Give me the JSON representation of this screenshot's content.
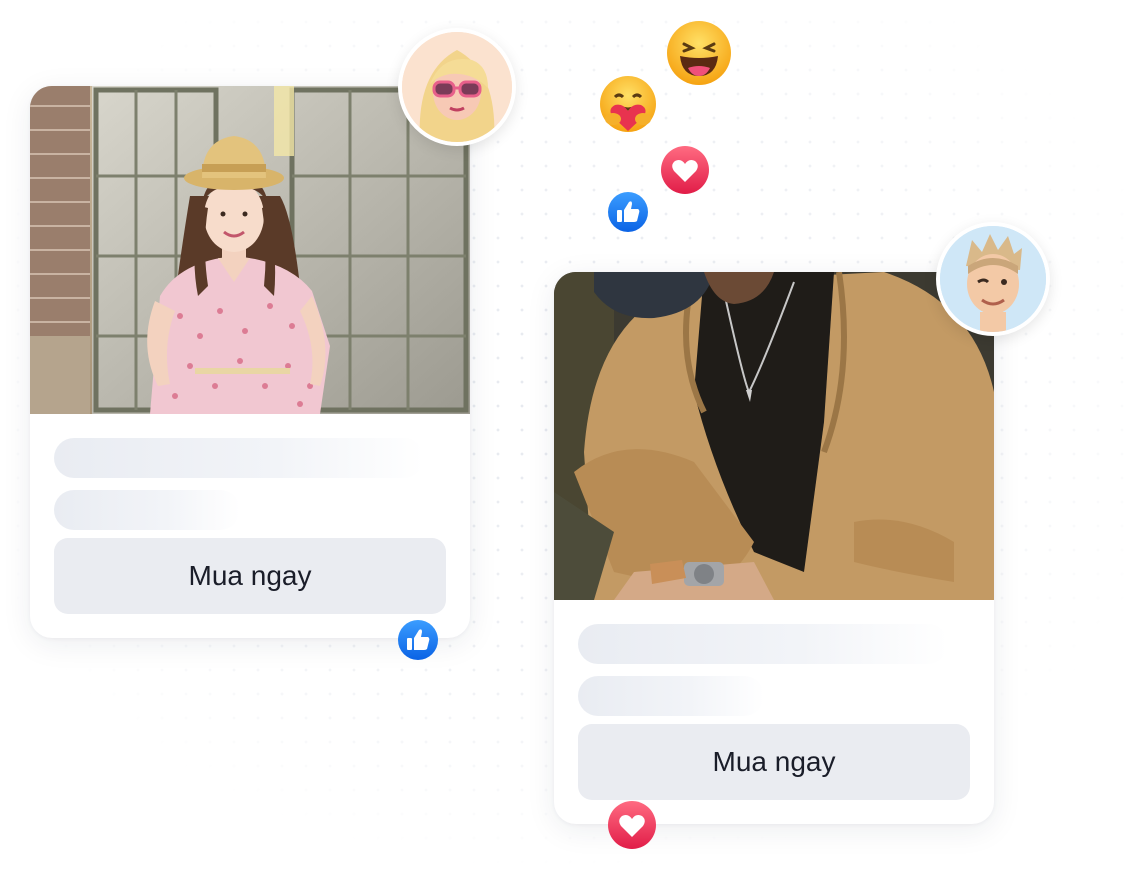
{
  "cards": [
    {
      "id": "woman-dress",
      "image_subject": "woman in pink floral dress and straw hat",
      "button_label": "Mua ngay"
    },
    {
      "id": "man-jacket",
      "image_subject": "man in tan jacket and cap wearing watch",
      "button_label": "Mua ngay"
    }
  ],
  "colors": {
    "like_blue": "#1877f2",
    "love_red": "#f0284a",
    "haha_yellow": "#fbbf24",
    "button_bg": "#eaecf1",
    "button_text": "#1a1d29",
    "skeleton": "#e9ecf2"
  },
  "icons": [
    "like-reaction-icon",
    "love-reaction-icon",
    "haha-reaction-icon",
    "care-reaction-icon"
  ]
}
